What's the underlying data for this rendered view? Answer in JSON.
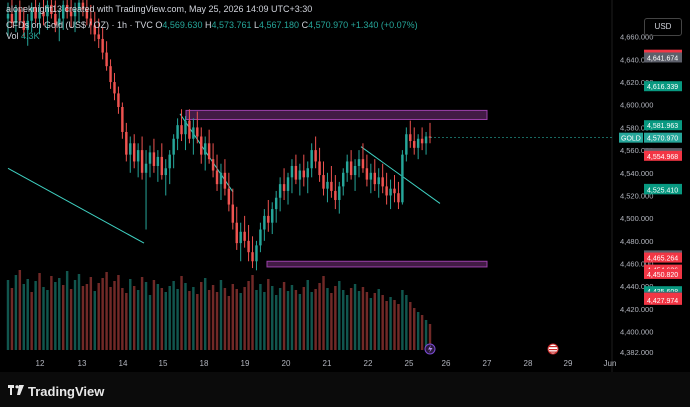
{
  "header": {
    "creator": "aloneknight13 created with TradingView.com, May 25, 2026 14:09 UTC+3:30",
    "symbol_line": "CFDs on Gold (US$ / OZ) · 1h · TVC",
    "ohlc": [
      {
        "key": "O",
        "value": "4,569.630"
      },
      {
        "key": "H",
        "value": "4,573.761"
      },
      {
        "key": "L",
        "value": "4,567.180"
      },
      {
        "key": "C",
        "value": "4,570.970"
      }
    ],
    "change": "+1.340 (+0.07%)",
    "volume_label": "Vol",
    "volume_value": "4.3K"
  },
  "currency_button": "USD",
  "footer": {
    "brand": "TradingView"
  },
  "colors": {
    "up": "#26a69a",
    "down": "#ef5350",
    "zone_border": "#ab47bc",
    "zone_fill": "#4a1f4d",
    "trend_line": "#3fd1c2",
    "tag_green": "#089981",
    "tag_red": "#f23645",
    "tag_gray": "#5d606b"
  },
  "chart_data": {
    "type": "candlestick",
    "ylim": [
      4382,
      4680
    ],
    "y_ticks": [
      "4,660.000",
      "4,640.000",
      "4,620.000",
      "4,600.000",
      "4,580.000",
      "4,560.000",
      "4,540.000",
      "4,520.000",
      "4,500.000",
      "4,480.000",
      "4,460.000",
      "4,440.000",
      "4,420.000",
      "4,400.000",
      "4,382.000"
    ],
    "x_ticks": [
      "12",
      "13",
      "14",
      "15",
      "18",
      "19",
      "20",
      "21",
      "22",
      "25",
      "26",
      "27",
      "28",
      "29",
      "Jun"
    ],
    "last_price": {
      "label": "GOLD",
      "value": "4,570.970"
    },
    "price_tags": [
      {
        "value": "4,644.130",
        "kind": "red"
      },
      {
        "value": "4,641.674",
        "kind": "gray"
      },
      {
        "value": "4,616.339",
        "kind": "green"
      },
      {
        "value": "4,581.963",
        "kind": "green"
      },
      {
        "value": "4,557.381",
        "kind": "gray"
      },
      {
        "value": "4,554.968",
        "kind": "red"
      },
      {
        "value": "4,525.767",
        "kind": "green"
      },
      {
        "value": "4,525.767",
        "kind": "green"
      },
      {
        "value": "4,525.410",
        "kind": "green"
      },
      {
        "value": "4,467.177",
        "kind": "gray"
      },
      {
        "value": "4,465.264",
        "kind": "red"
      },
      {
        "value": "4,454.636",
        "kind": "red"
      },
      {
        "value": "4,450.820",
        "kind": "red"
      },
      {
        "value": "4,435.608",
        "kind": "green"
      },
      {
        "value": "4,430.800",
        "kind": "gray"
      },
      {
        "value": "4,429.669",
        "kind": "red"
      },
      {
        "value": "4,428.327",
        "kind": "red"
      },
      {
        "value": "4,427.974",
        "kind": "red"
      }
    ],
    "zones": [
      {
        "name": "resistance",
        "low": 4587,
        "high": 4595,
        "x_start": "Fri 15 late",
        "x_end": "Mon 25 late"
      },
      {
        "name": "support",
        "low": 4457,
        "high": 4462,
        "x_start": "Mon 18 late",
        "x_end": "Mon 25 late"
      }
    ],
    "trend_lines": [
      {
        "name": "long-downtrend",
        "from": {
          "day": "11",
          "price": 4544
        },
        "to": {
          "day": "14",
          "price": 4478
        }
      },
      {
        "name": "drop-line",
        "from": {
          "day": "15",
          "price": 4592
        },
        "to": {
          "day": "18",
          "price": 4523
        }
      },
      {
        "name": "wedge-line",
        "from": {
          "day": "22",
          "price": 4563
        },
        "to": {
          "day": "25",
          "price": 4513
        }
      }
    ],
    "candles": [
      [
        4676,
        4690,
        4660,
        4680
      ],
      [
        4680,
        4695,
        4668,
        4672
      ],
      [
        4672,
        4688,
        4664,
        4684
      ],
      [
        4684,
        4692,
        4670,
        4674
      ],
      [
        4674,
        4686,
        4660,
        4666
      ],
      [
        4666,
        4680,
        4652,
        4674
      ],
      [
        4674,
        4690,
        4664,
        4686
      ],
      [
        4686,
        4696,
        4672,
        4676
      ],
      [
        4676,
        4690,
        4662,
        4682
      ],
      [
        4682,
        4694,
        4670,
        4678
      ],
      [
        4678,
        4692,
        4666,
        4688
      ],
      [
        4688,
        4698,
        4676,
        4680
      ],
      [
        4680,
        4692,
        4664,
        4670
      ],
      [
        4670,
        4684,
        4656,
        4676
      ],
      [
        4676,
        4692,
        4666,
        4688
      ],
      [
        4688,
        4700,
        4676,
        4682
      ],
      [
        4682,
        4694,
        4668,
        4678
      ],
      [
        4678,
        4690,
        4664,
        4684
      ],
      [
        4684,
        4696,
        4672,
        4690
      ],
      [
        4690,
        4700,
        4678,
        4684
      ],
      [
        4684,
        4694,
        4670,
        4676
      ],
      [
        4676,
        4688,
        4662,
        4670
      ],
      [
        4670,
        4682,
        4656,
        4662
      ],
      [
        4662,
        4676,
        4650,
        4658
      ],
      [
        4658,
        4668,
        4640,
        4646
      ],
      [
        4646,
        4656,
        4630,
        4634
      ],
      [
        4634,
        4640,
        4614,
        4620
      ],
      [
        4620,
        4628,
        4604,
        4610
      ],
      [
        4610,
        4616,
        4592,
        4598
      ],
      [
        4598,
        4602,
        4570,
        4576
      ],
      [
        4576,
        4584,
        4550,
        4556
      ],
      [
        4556,
        4572,
        4540,
        4566
      ],
      [
        4566,
        4574,
        4544,
        4550
      ],
      [
        4550,
        4566,
        4536,
        4560
      ],
      [
        4560,
        4572,
        4534,
        4540
      ],
      [
        4540,
        4560,
        4490,
        4548
      ],
      [
        4548,
        4564,
        4536,
        4558
      ],
      [
        4558,
        4570,
        4540,
        4546
      ],
      [
        4546,
        4560,
        4532,
        4554
      ],
      [
        4554,
        4566,
        4534,
        4538
      ],
      [
        4538,
        4552,
        4520,
        4544
      ],
      [
        4544,
        4560,
        4530,
        4556
      ],
      [
        4556,
        4574,
        4544,
        4570
      ],
      [
        4570,
        4588,
        4560,
        4582
      ],
      [
        4582,
        4596,
        4568,
        4574
      ],
      [
        4574,
        4590,
        4560,
        4586
      ],
      [
        4586,
        4596,
        4566,
        4570
      ],
      [
        4570,
        4588,
        4556,
        4580
      ],
      [
        4580,
        4594,
        4566,
        4572
      ],
      [
        4572,
        4580,
        4548,
        4556
      ],
      [
        4556,
        4572,
        4542,
        4566
      ],
      [
        4566,
        4578,
        4548,
        4552
      ],
      [
        4552,
        4566,
        4536,
        4542
      ],
      [
        4542,
        4556,
        4524,
        4530
      ],
      [
        4530,
        4548,
        4516,
        4540
      ],
      [
        4540,
        4552,
        4520,
        4526
      ],
      [
        4526,
        4540,
        4506,
        4512
      ],
      [
        4512,
        4526,
        4490,
        4496
      ],
      [
        4496,
        4510,
        4472,
        4478
      ],
      [
        4478,
        4496,
        4462,
        4488
      ],
      [
        4488,
        4502,
        4474,
        4480
      ],
      [
        4480,
        4494,
        4462,
        4470
      ],
      [
        4470,
        4484,
        4456,
        4462
      ],
      [
        4462,
        4480,
        4454,
        4476
      ],
      [
        4476,
        4496,
        4470,
        4490
      ],
      [
        4490,
        4508,
        4480,
        4502
      ],
      [
        4502,
        4516,
        4488,
        4496
      ],
      [
        4496,
        4514,
        4486,
        4508
      ],
      [
        4508,
        4524,
        4496,
        4518
      ],
      [
        4518,
        4536,
        4506,
        4530
      ],
      [
        4530,
        4544,
        4516,
        4524
      ],
      [
        4524,
        4540,
        4512,
        4536
      ],
      [
        4536,
        4552,
        4522,
        4546
      ],
      [
        4546,
        4556,
        4530,
        4534
      ],
      [
        4534,
        4548,
        4520,
        4542
      ],
      [
        4542,
        4556,
        4528,
        4536
      ],
      [
        4536,
        4550,
        4522,
        4544
      ],
      [
        4544,
        4566,
        4536,
        4560
      ],
      [
        4560,
        4572,
        4544,
        4550
      ],
      [
        4550,
        4562,
        4532,
        4538
      ],
      [
        4538,
        4550,
        4520,
        4526
      ],
      [
        4526,
        4540,
        4514,
        4532
      ],
      [
        4532,
        4546,
        4518,
        4524
      ],
      [
        4524,
        4538,
        4508,
        4516
      ],
      [
        4516,
        4532,
        4504,
        4528
      ],
      [
        4528,
        4544,
        4520,
        4540
      ],
      [
        4540,
        4556,
        4532,
        4550
      ],
      [
        4550,
        4560,
        4534,
        4538
      ],
      [
        4538,
        4552,
        4524,
        4546
      ],
      [
        4546,
        4560,
        4536,
        4552
      ],
      [
        4552,
        4566,
        4540,
        4544
      ],
      [
        4544,
        4556,
        4528,
        4534
      ],
      [
        4534,
        4548,
        4522,
        4540
      ],
      [
        4540,
        4552,
        4524,
        4530
      ],
      [
        4530,
        4544,
        4518,
        4536
      ],
      [
        4536,
        4548,
        4522,
        4528
      ],
      [
        4528,
        4540,
        4512,
        4520
      ],
      [
        4520,
        4534,
        4508,
        4526
      ],
      [
        4526,
        4538,
        4514,
        4522
      ],
      [
        4522,
        4532,
        4508,
        4514
      ],
      [
        4514,
        4560,
        4512,
        4556
      ],
      [
        4556,
        4580,
        4550,
        4574
      ],
      [
        4574,
        4586,
        4562,
        4568
      ],
      [
        4568,
        4580,
        4556,
        4562
      ],
      [
        4562,
        4574,
        4552,
        4570
      ],
      [
        4570,
        4580,
        4560,
        4566
      ],
      [
        4566,
        4576,
        4556,
        4572
      ],
      [
        4572,
        4584,
        4566,
        4571
      ]
    ],
    "volume": [
      0.7,
      0.62,
      0.75,
      0.8,
      0.66,
      0.71,
      0.58,
      0.69,
      0.77,
      0.63,
      0.6,
      0.74,
      0.68,
      0.72,
      0.65,
      0.79,
      0.61,
      0.7,
      0.76,
      0.64,
      0.66,
      0.73,
      0.59,
      0.67,
      0.72,
      0.78,
      0.63,
      0.69,
      0.75,
      0.62,
      0.57,
      0.71,
      0.64,
      0.6,
      0.73,
      0.68,
      0.55,
      0.7,
      0.66,
      0.62,
      0.58,
      0.64,
      0.69,
      0.61,
      0.74,
      0.67,
      0.59,
      0.63,
      0.56,
      0.68,
      0.72,
      0.6,
      0.65,
      0.58,
      0.7,
      0.62,
      0.54,
      0.66,
      0.61,
      0.57,
      0.63,
      0.69,
      0.75,
      0.6,
      0.66,
      0.58,
      0.71,
      0.64,
      0.55,
      0.62,
      0.68,
      0.59,
      0.65,
      0.6,
      0.56,
      0.63,
      0.7,
      0.58,
      0.61,
      0.67,
      0.74,
      0.62,
      0.57,
      0.64,
      0.69,
      0.6,
      0.55,
      0.62,
      0.66,
      0.59,
      0.63,
      0.58,
      0.52,
      0.57,
      0.61,
      0.55,
      0.49,
      0.53,
      0.5,
      0.46,
      0.6,
      0.55,
      0.48,
      0.42,
      0.38,
      0.35,
      0.3,
      0.26
    ],
    "volume_up": [
      true,
      false,
      true,
      false,
      true,
      true,
      false,
      true,
      false,
      true,
      true,
      false,
      true,
      true,
      false,
      true,
      false,
      true,
      true,
      false,
      false,
      false,
      true,
      false,
      false,
      false,
      false,
      false,
      false,
      false,
      false,
      true,
      false,
      true,
      false,
      true,
      true,
      false,
      true,
      false,
      true,
      true,
      true,
      true,
      false,
      true,
      false,
      true,
      false,
      false,
      true,
      false,
      false,
      false,
      true,
      false,
      false,
      false,
      false,
      true,
      false,
      false,
      false,
      true,
      true,
      true,
      false,
      true,
      true,
      true,
      false,
      true,
      true,
      false,
      true,
      false,
      true,
      true,
      false,
      false,
      false,
      true,
      false,
      false,
      true,
      true,
      true,
      false,
      true,
      true,
      false,
      false,
      true,
      false,
      true,
      false,
      false,
      true,
      false,
      false,
      true,
      true,
      false,
      false,
      true,
      false,
      true,
      false
    ]
  }
}
